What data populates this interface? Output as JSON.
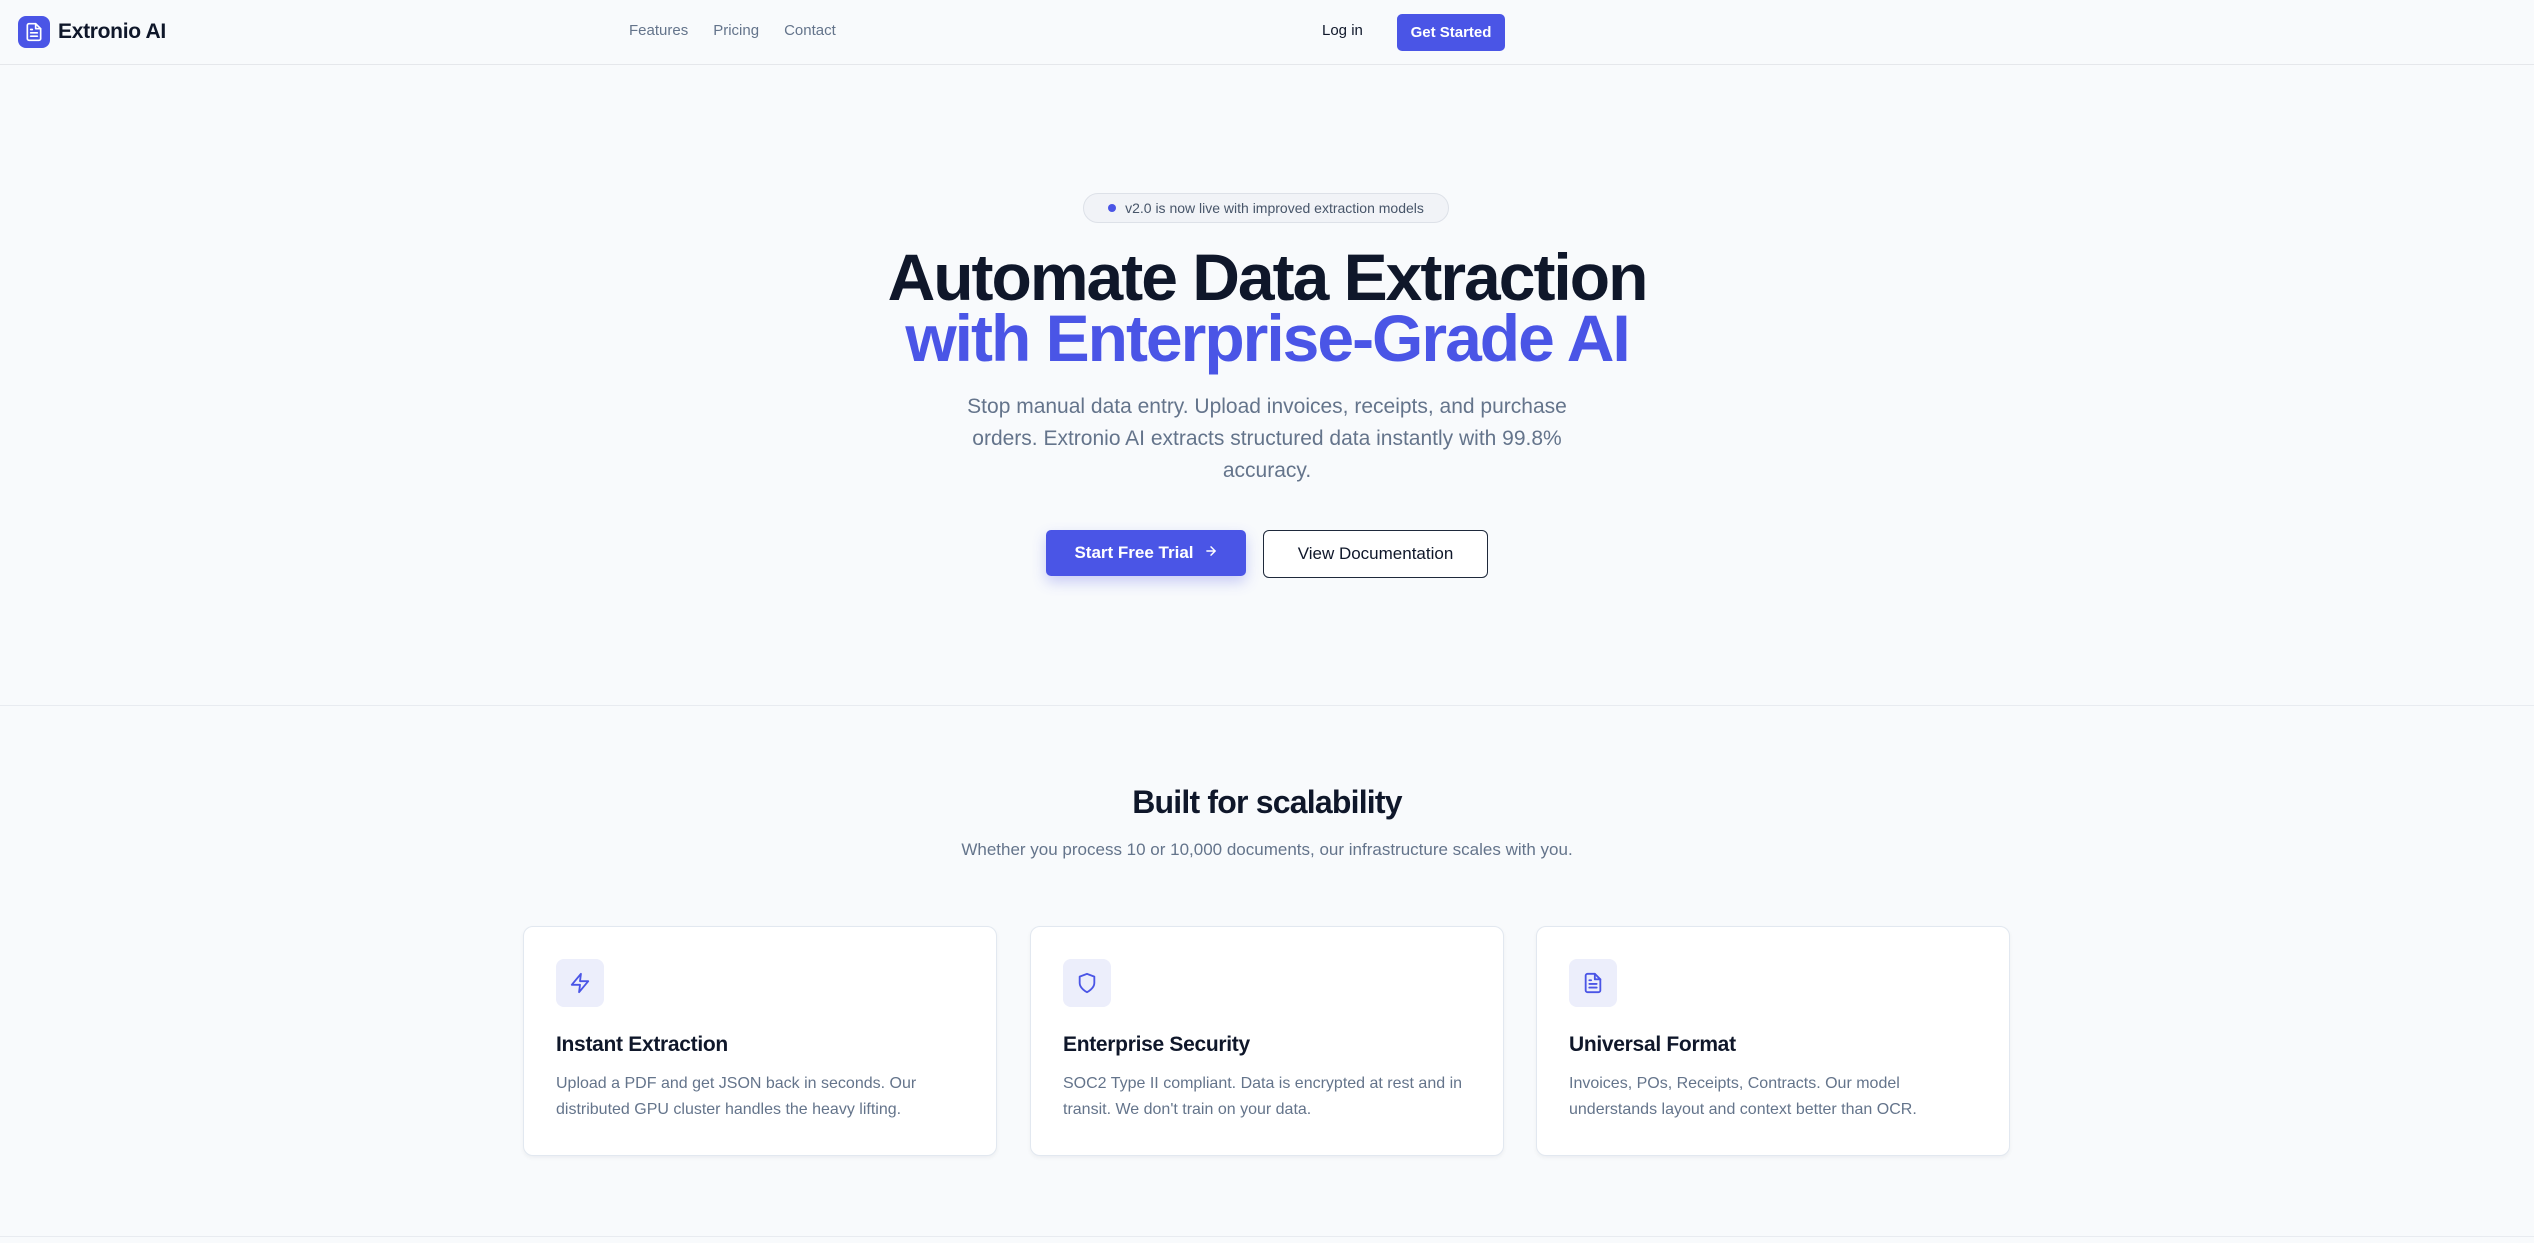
{
  "nav": {
    "brand": "Extronio AI",
    "brand_icon": "document-icon",
    "links": [
      "Features",
      "Pricing",
      "Contact"
    ],
    "login": "Log in",
    "cta": "Get Started"
  },
  "hero": {
    "badge": "v2.0 is now live with improved extraction models",
    "title_line1": "Automate Data Extraction",
    "title_line2": "with Enterprise-Grade AI",
    "subtitle": "Stop manual data entry. Upload invoices, receipts, and purchase orders. Extronio AI extracts structured data instantly with 99.8% accuracy.",
    "primary_button": "Start Free Trial",
    "primary_button_icon": "arrow-right-icon",
    "secondary_button": "View Documentation"
  },
  "features": {
    "title": "Built for scalability",
    "subtitle": "Whether you process 10 or 10,000 documents, our infrastructure scales with you.",
    "cards": [
      {
        "icon": "lightning-icon",
        "title": "Instant Extraction",
        "desc": "Upload a PDF and get JSON back in seconds. Our distributed GPU cluster handles the heavy lifting."
      },
      {
        "icon": "shield-icon",
        "title": "Enterprise Security",
        "desc": "SOC2 Type II compliant. Data is encrypted at rest and in transit. We don't train on your data."
      },
      {
        "icon": "document-icon",
        "title": "Universal Format",
        "desc": "Invoices, POs, Receipts, Contracts. Our model understands layout and context better than OCR."
      }
    ]
  },
  "colors": {
    "accent": "#4a55e6",
    "text": "#0f172a",
    "muted": "#64748b",
    "background": "#f8fafc"
  }
}
